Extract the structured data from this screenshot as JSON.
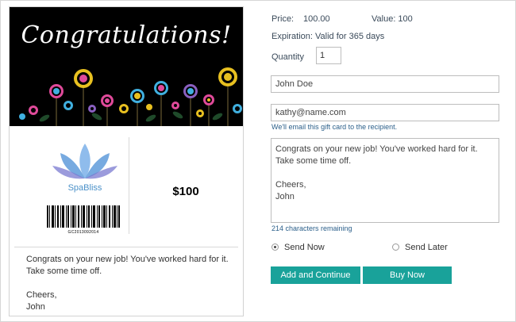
{
  "card": {
    "banner_title": "Congratulations!",
    "logo_text": "SpaBliss",
    "barcode_number": "GC2013092014",
    "amount": "$100",
    "message": "Congrats on your new job! You've worked hard for it.\nTake some time off.\n\nCheers,\nJohn"
  },
  "form": {
    "price_label": "Price:",
    "price_value": "100.00",
    "value_label": "Value: 100",
    "expiration": "Expiration: Valid for 365 days",
    "quantity_label": "Quantity",
    "quantity_value": "1",
    "name_value": "John Doe",
    "email_value": "kathy@name.com",
    "email_hint": "We'll email this gift card to the recipient.",
    "message_value": "Congrats on your new job! You've worked hard for it.\nTake some time off.\n\nCheers,\nJohn",
    "chars_remaining": "214 characters remaining",
    "send_now_label": "Send Now",
    "send_later_label": "Send Later",
    "send_option_selected": "Send Now",
    "add_continue_label": "Add and Continue",
    "buy_now_label": "Buy Now"
  },
  "colors": {
    "accent": "#19a29a",
    "banner_bg": "#000000",
    "link_text": "#2b5f8a"
  },
  "icons": [
    "lotus-logo-icon",
    "barcode-icon",
    "flower-illustration"
  ]
}
